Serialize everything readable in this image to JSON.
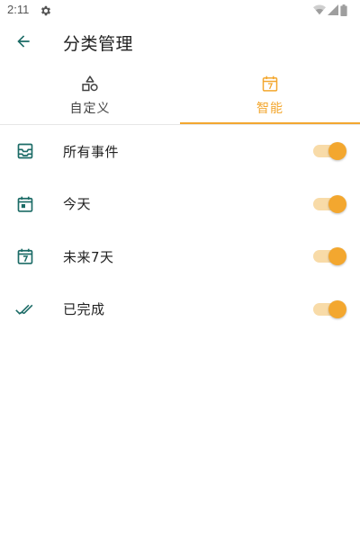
{
  "status_bar": {
    "time": "2:11",
    "settings_icon": "gear-icon",
    "wifi_icon": "wifi-icon",
    "signal_icon": "signal-icon",
    "battery_icon": "battery-icon"
  },
  "app_bar": {
    "back_icon": "arrow-left-icon",
    "title": "分类管理"
  },
  "tabs": [
    {
      "label": "自定义",
      "icon": "shapes-icon",
      "active": false
    },
    {
      "label": "智能",
      "icon": "calendar-7-icon",
      "active": true
    }
  ],
  "smart_items": [
    {
      "label": "所有事件",
      "icon": "inbox-icon",
      "enabled": true
    },
    {
      "label": "今天",
      "icon": "calendar-today-icon",
      "enabled": true
    },
    {
      "label": "未来7天",
      "icon": "calendar-7-icon",
      "enabled": true
    },
    {
      "label": "已完成",
      "icon": "done-all-icon",
      "enabled": true
    }
  ],
  "colors": {
    "accent": "#F3A72F",
    "accent_track": "#F8DBA8",
    "icon_teal": "#1B6B66",
    "text_primary": "#212121"
  }
}
